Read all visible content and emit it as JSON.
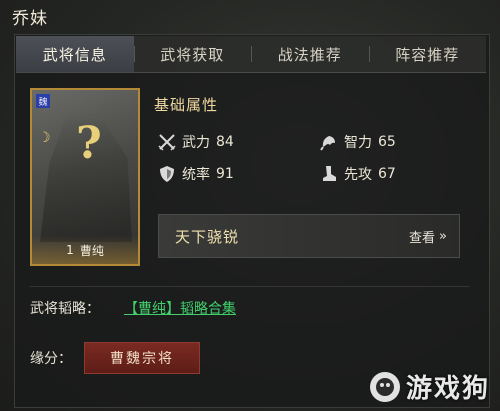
{
  "window_title": "乔妹",
  "tabs": [
    {
      "label": "武将信息",
      "active": true
    },
    {
      "label": "武将获取",
      "active": false
    },
    {
      "label": "战法推荐",
      "active": false
    },
    {
      "label": "阵容推荐",
      "active": false
    }
  ],
  "card": {
    "faction": "魏",
    "cost": "1",
    "name": "曹纯"
  },
  "attributes": {
    "title": "基础属性",
    "force": {
      "label": "武力",
      "value": "84",
      "icon": "crossed-swords-icon"
    },
    "intellect": {
      "label": "智力",
      "value": "65",
      "icon": "brain-icon"
    },
    "command": {
      "label": "统率",
      "value": "91",
      "icon": "shield-icon"
    },
    "speed": {
      "label": "先攻",
      "value": "67",
      "icon": "boot-icon"
    }
  },
  "trait": {
    "name": "天下骁锐",
    "view_label": "查看",
    "view_icon": "double-chevron-right-icon"
  },
  "strategy": {
    "label": "武将韬略：",
    "link_text": "【曹纯】韬略合集"
  },
  "fate": {
    "label": "缘分：",
    "badge": "曹魏宗将"
  },
  "watermark": "游戏狗",
  "colors": {
    "accent_gold": "#b48a38",
    "link_green": "#3fd06b",
    "fate_red": "#6e231d"
  }
}
